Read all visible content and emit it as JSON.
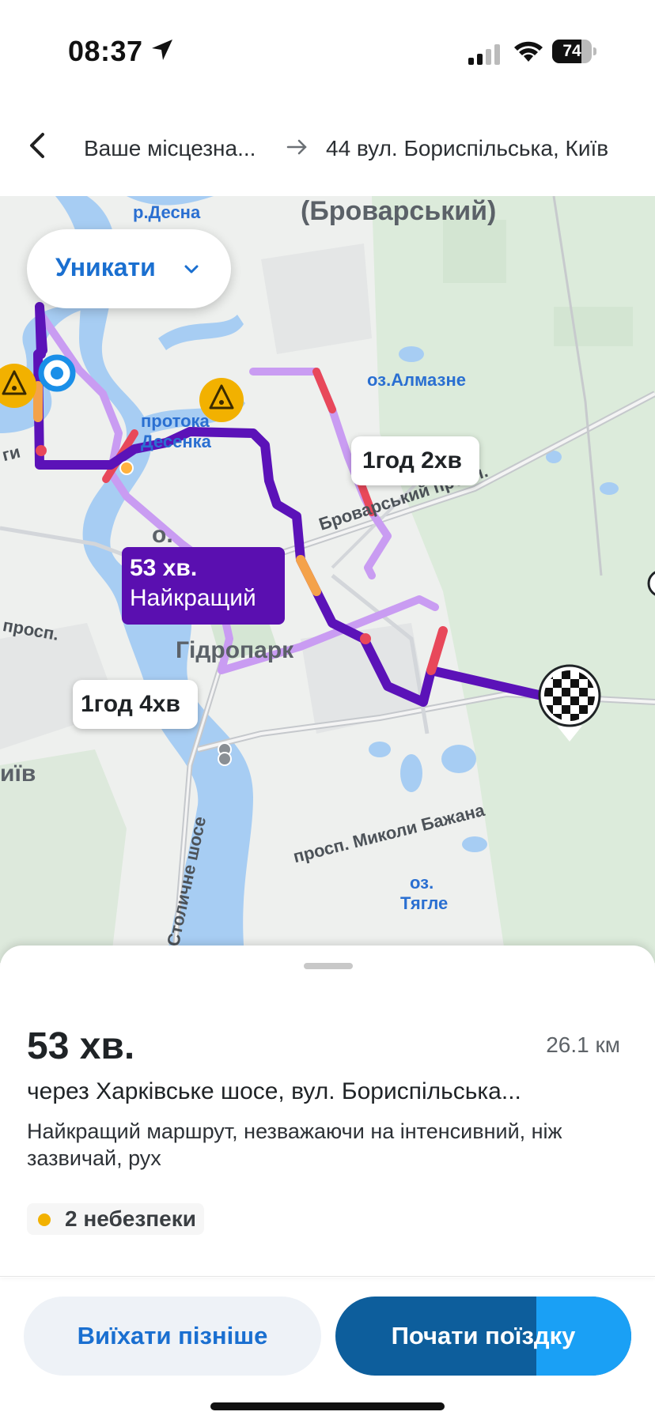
{
  "status_bar": {
    "time": "08:37",
    "battery": "74",
    "battery_level": 0.74
  },
  "header": {
    "from": "Ваше місцезна...",
    "to": "44 вул. Бориспільська, Київ"
  },
  "map": {
    "avoid_button": "Уникати",
    "labels": {
      "desna": "р.Десна",
      "brovarskyi": "(Броварський)",
      "almazne": "оз.Алмазне",
      "protoka_line1": "протока",
      "protoka_line2": "Десенка",
      "brovarskyi_prosp": "Броварський просп.",
      "hidropark": "Гідропарк",
      "prosp_left": "просп.",
      "kyiv_partial": "иїв",
      "gi_partial": "ги",
      "o_partial": "о.",
      "bazhana": "просп. Миколи Бажана",
      "stolychne": "Столичне шосе",
      "tyahle_line1": "оз.",
      "tyahle_line2": "Тягле"
    },
    "route_callouts": {
      "alt1": "1год 2хв",
      "alt2": "1год 4хв",
      "best_time": "53 хв.",
      "best_label": "Найкращий"
    },
    "colors": {
      "best_route": "#5b12b8",
      "alt_route": "#c99cf2",
      "traffic": "#e8485a",
      "hazard": "#f2b100"
    }
  },
  "sheet": {
    "eta": "53 хв.",
    "distance": "26.1 км",
    "via": "через Харківське шосе, вул. Бориспільська...",
    "description": "Найкращий маршрут, незважаючи на інтенсивний, ніж зазвичай, рух",
    "hazards": "2 небезпеки"
  },
  "buttons": {
    "later": "Виїхати пізніше",
    "start": "Почати поїздку",
    "start_progress": 0.32
  }
}
